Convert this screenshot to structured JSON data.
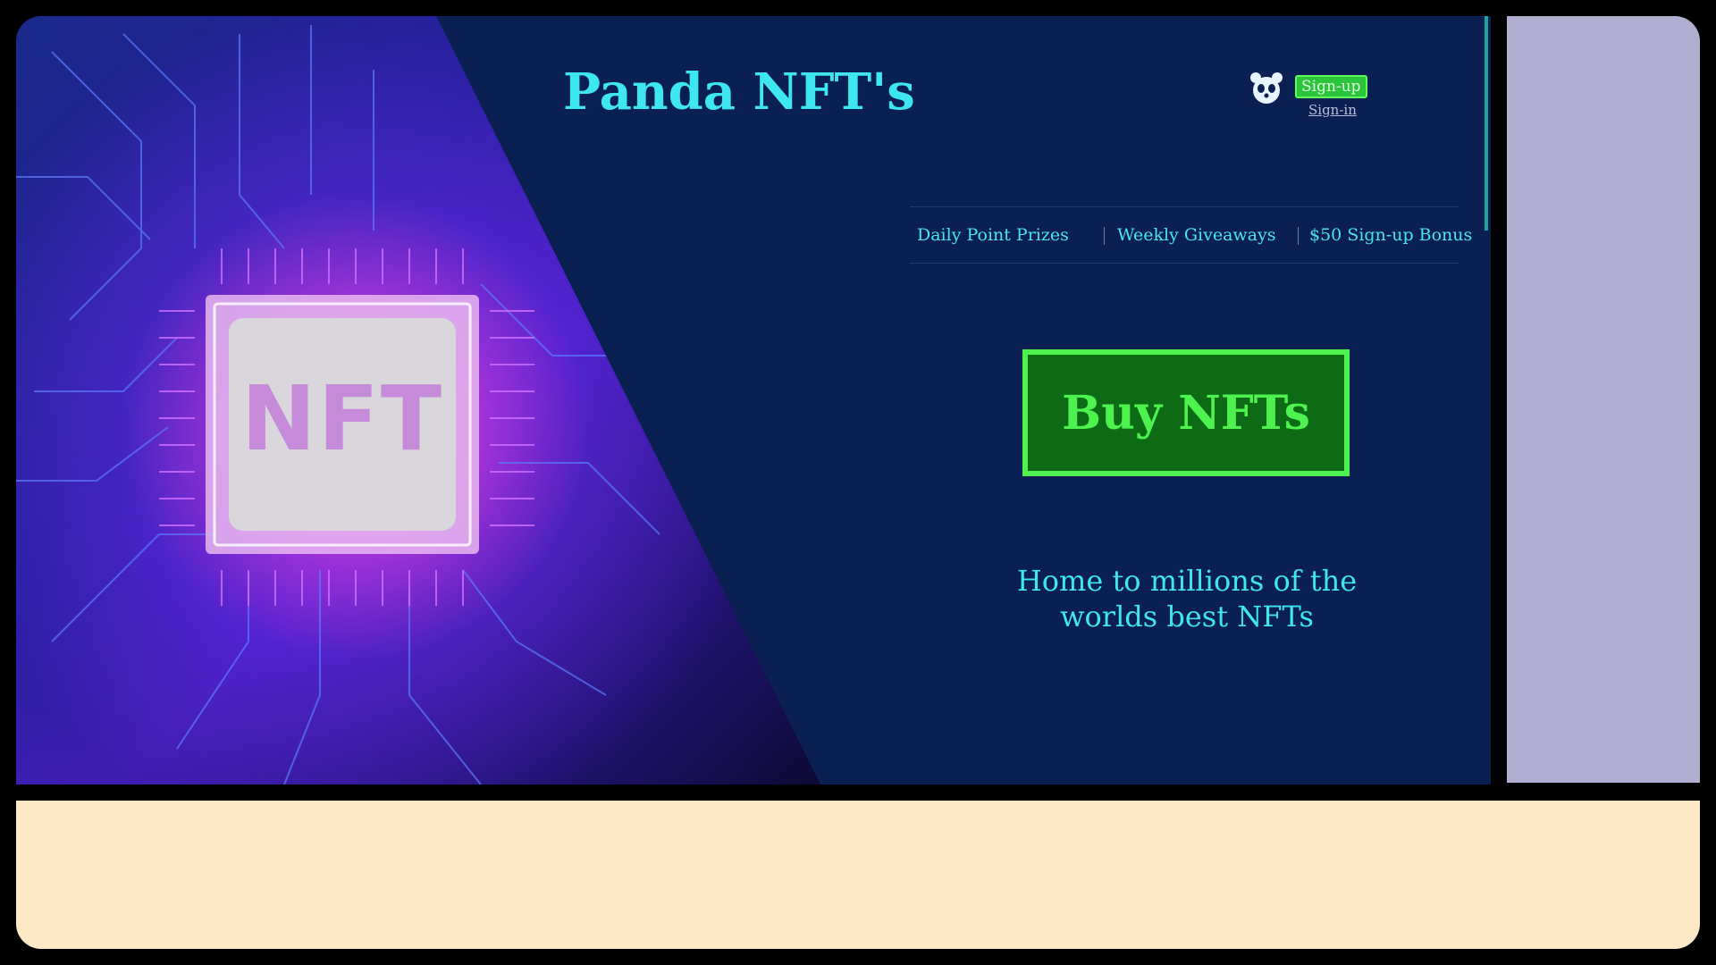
{
  "brand": {
    "title": "Panda NFT's"
  },
  "auth": {
    "signup_label": "Sign-up",
    "signin_label": "Sign-in"
  },
  "nav": {
    "items": [
      {
        "label": "Daily Point Prizes"
      },
      {
        "label": "Weekly Giveaways"
      },
      {
        "label": "$50 Sign-up Bonus"
      }
    ]
  },
  "hero": {
    "cta_label": "Buy NFTs",
    "tagline_line1": "Home to millions of the",
    "tagline_line2": "worlds best NFTs",
    "art_chip_text": "NFT"
  },
  "colors": {
    "hero_bg": "#0a1f52",
    "accent_cyan": "#3ee6ef",
    "cta_green": "#4ef24e",
    "cta_fill": "#0c6b14",
    "side_panel": "#b0afd2",
    "bottom_panel": "#ffe8c8"
  },
  "icons": {
    "panda": "panda-icon"
  }
}
